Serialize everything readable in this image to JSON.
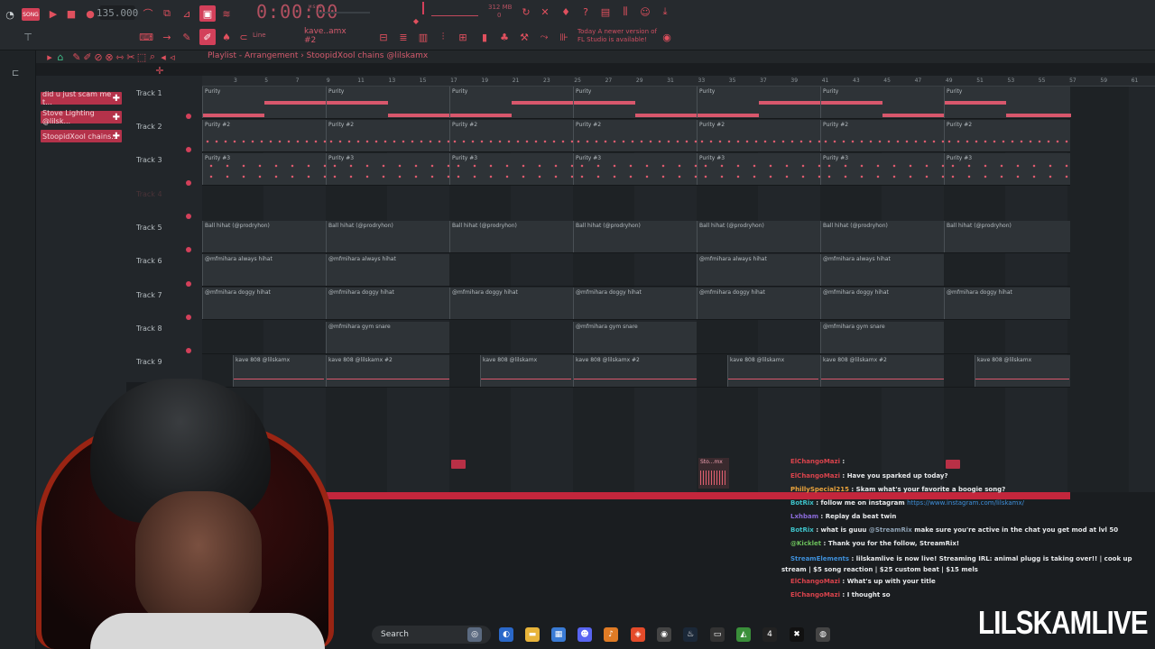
{
  "toolbar": {
    "mode_badge": "SONG",
    "tempo": "135.000",
    "time": "0:00:00",
    "time_sub": "M:S:CS",
    "memory": "312 MB",
    "memory_sub": "0",
    "pattern_name": "kave..amx #2",
    "snap_label": "Line",
    "news_line1": "Today   A newer version of",
    "news_line2": "FL Studio is available!"
  },
  "playlist": {
    "title": "Playlist - Arrangement  ›  StoopidXool chains @lilskamx",
    "patterns": [
      "did u just scam me t...",
      "Stove Lighting @lilsk...",
      "StoopidXool chains..."
    ],
    "tracks": [
      "Track 1",
      "Track 2",
      "Track 3",
      "Track 4",
      "Track 5",
      "Track 6",
      "Track 7",
      "Track 8",
      "Track 9"
    ],
    "ruler": [
      "3",
      "5",
      "7",
      "9",
      "11",
      "13",
      "15",
      "17",
      "19",
      "21",
      "23",
      "25",
      "27",
      "29",
      "31",
      "33",
      "35",
      "37",
      "39",
      "41",
      "43",
      "45",
      "47",
      "49",
      "51",
      "53",
      "55",
      "57",
      "59",
      "61"
    ],
    "clip_labels": {
      "t1": "Purity",
      "t2": "Purity #2",
      "t3": "Purity #3",
      "t5": "Ball hihat (@prodryhon)",
      "t6": "@mfmihara always hihat",
      "t7": "@mfmihara doggy hihat",
      "t8": "@mfmihara gym snare",
      "t9a": "kave 808 @lilskamx",
      "t9b": "kave 808 @lilskamx #2",
      "sto": "Sto...mx"
    }
  },
  "taskbar": {
    "search_label": "Search"
  },
  "chat": [
    {
      "user": "ElChangoMazi",
      "msg": "",
      "color": "#d9434c"
    },
    {
      "user": "ElChangoMazi",
      "msg": "Have you sparked up today?",
      "color": "#d9434c"
    },
    {
      "user": "PhillySpecial215",
      "msg": "Skam what's your favorite a boogie song?",
      "color": "#e9a23b"
    },
    {
      "user": "BotRix",
      "msg": "follow me on instagram",
      "link": "https://www.instagram.com/lilskamx/",
      "color": "#3ec2c9"
    },
    {
      "user": "Lxhbam",
      "msg": "Replay da beat twin",
      "color": "#8b6bd9"
    },
    {
      "user": "BotRix",
      "msg": "what is guuu",
      "mention": "@StreamRix",
      "msg2": "make sure you're active in the chat you get mod at lvl 50",
      "color": "#3ec2c9"
    },
    {
      "user": "@Kicklet",
      "msg": "Thank you for the follow, StreamRix!",
      "color": "#6bbf5a"
    },
    {
      "user": "StreamElements",
      "msg": "lilskamlive is now live! Streaming IRL: animal plugg is taking over!! | cook up stream | $5 song reaction | $25 custom beat | $15 mels",
      "color": "#3e8fd9"
    },
    {
      "user": "ElChangoMazi",
      "msg": "What's up with your title",
      "color": "#d9434c"
    },
    {
      "user": "ElChangoMazi",
      "msg": "I thought so",
      "color": "#d9434c"
    }
  ],
  "watermark": "LILSKAMLIVE",
  "colors": {
    "accent": "#d3405a",
    "bg": "#1a1d20",
    "chat_link": "#3e8fd9"
  }
}
